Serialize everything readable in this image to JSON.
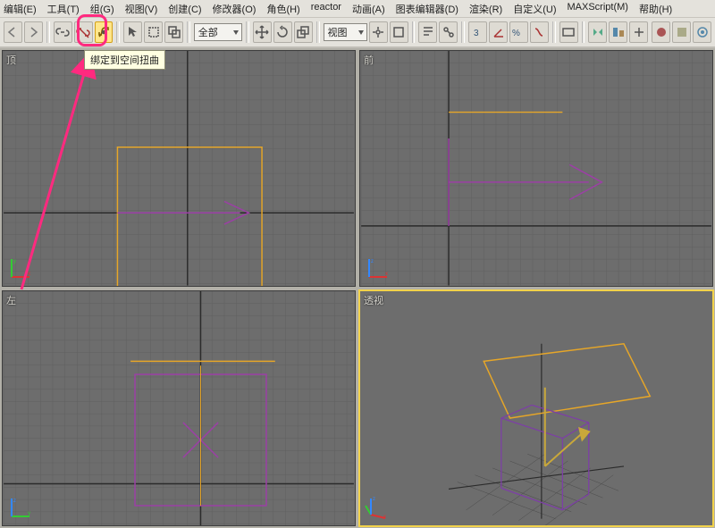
{
  "menubar": {
    "items": [
      "编辑(E)",
      "工具(T)",
      "组(G)",
      "视图(V)",
      "创建(C)",
      "修改器(O)",
      "角色(H)",
      "reactor",
      "动画(A)",
      "图表编辑器(D)",
      "渲染(R)",
      "自定义(U)",
      "MAXScript(M)",
      "帮助(H)"
    ]
  },
  "toolbar": {
    "selection_filter": "全部",
    "viewport_mode": "视图",
    "tooltip_text": "绑定到空间扭曲",
    "icons": [
      "undo",
      "redo",
      "link",
      "unlink",
      "spacewarp-bind",
      "sep",
      "pointer",
      "rect-select",
      "window-crossing",
      "sep",
      "filter-combo",
      "sep",
      "move",
      "rotate",
      "scale",
      "sep",
      "refsys-combo",
      "sep",
      "center-pivot",
      "tool-a",
      "sep",
      "select-name",
      "select-color",
      "sep",
      "snap-toggle",
      "angle-snap",
      "percent-snap",
      "spinner-snap",
      "sep",
      "named-sets",
      "sep",
      "mirror",
      "align",
      "quick-align",
      "sep",
      "more-a",
      "more-b",
      "far-r",
      "material-editor",
      "render-setup",
      "render"
    ]
  },
  "viewports": {
    "top": {
      "label": "顶"
    },
    "front": {
      "label": "前"
    },
    "left": {
      "label": "左"
    },
    "persp": {
      "label": "透视"
    }
  },
  "annotation": {
    "highlight_target": "toolbar-spacewarp-bind-button"
  }
}
